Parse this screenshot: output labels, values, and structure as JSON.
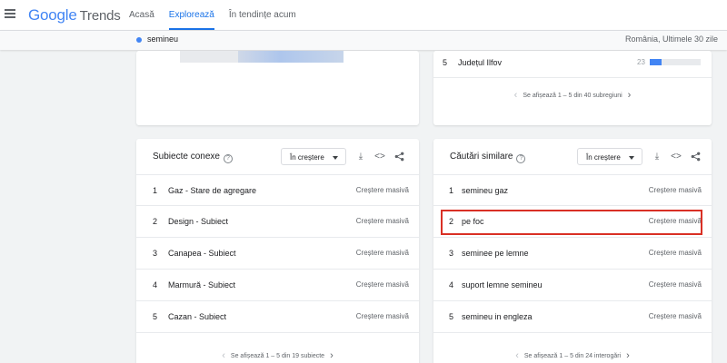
{
  "header": {
    "logo_google": "Google",
    "logo_trends": "Trends",
    "nav": [
      {
        "label": "Acasă",
        "active": false
      },
      {
        "label": "Explorează",
        "active": true
      },
      {
        "label": "În tendințe acum",
        "active": false
      }
    ]
  },
  "term_bar": {
    "term": "semineu",
    "meta": "România, Ultimele 30 zile",
    "dot_color": "#4285f4"
  },
  "regions": {
    "row": {
      "rank": "5",
      "name": "Județul Ilfov",
      "value": "23",
      "fill_fraction": 0.23
    },
    "pager": "Se afișează 1 – 5 din 40 subregiuni"
  },
  "related_topics": {
    "title": "Subiecte conexe",
    "filter": "În creștere",
    "rows": [
      {
        "rank": "1",
        "label": "Gaz - Stare de agregare",
        "value": "Creștere masivă"
      },
      {
        "rank": "2",
        "label": "Design - Subiect",
        "value": "Creștere masivă"
      },
      {
        "rank": "3",
        "label": "Canapea - Subiect",
        "value": "Creștere masivă"
      },
      {
        "rank": "4",
        "label": "Marmură - Subiect",
        "value": "Creștere masivă"
      },
      {
        "rank": "5",
        "label": "Cazan - Subiect",
        "value": "Creștere masivă"
      }
    ],
    "pager": "Se afișează 1 – 5 din 19 subiecte"
  },
  "related_queries": {
    "title": "Căutări similare",
    "filter": "În creștere",
    "rows": [
      {
        "rank": "1",
        "label": "semineu gaz",
        "value": "Creștere masivă"
      },
      {
        "rank": "2",
        "label": "pe foc",
        "value": "Creștere masivă"
      },
      {
        "rank": "3",
        "label": "seminee pe lemne",
        "value": "Creștere masivă"
      },
      {
        "rank": "4",
        "label": "suport lemne semineu",
        "value": "Creștere masivă"
      },
      {
        "rank": "5",
        "label": "semineu in engleza",
        "value": "Creștere masivă"
      }
    ],
    "pager": "Se afișează 1 – 5 din 24 interogări"
  },
  "icons": {
    "help": "?",
    "download": "⤓",
    "embed": "<>",
    "share": "share-icon",
    "prev": "‹",
    "next": "›"
  },
  "colors": {
    "accent": "#1a73e8",
    "highlight_box": "#d93025"
  }
}
